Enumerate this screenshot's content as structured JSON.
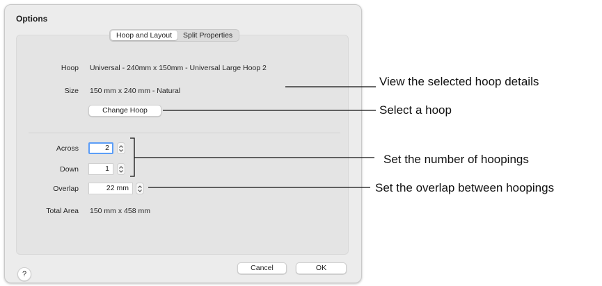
{
  "dialog": {
    "title": "Options",
    "tabs": [
      {
        "label": "Hoop and Layout",
        "active": true
      },
      {
        "label": "Split Properties",
        "active": false
      }
    ],
    "hoop": {
      "label": "Hoop",
      "value": "Universal - 240mm x 150mm - Universal Large Hoop 2"
    },
    "size": {
      "label": "Size",
      "value": "150 mm x 240 mm - Natural"
    },
    "change_hoop_label": "Change Hoop",
    "across": {
      "label": "Across",
      "value": "2"
    },
    "down": {
      "label": "Down",
      "value": "1"
    },
    "overlap": {
      "label": "Overlap",
      "value": "22 mm"
    },
    "total_area": {
      "label": "Total Area",
      "value": "150 mm x 458 mm"
    },
    "help_label": "?",
    "cancel_label": "Cancel",
    "ok_label": "OK"
  },
  "callouts": {
    "hoop_details": "View the selected hoop details",
    "select_hoop": "Select a hoop",
    "hoopings": "Set the number of hoopings",
    "overlap": "Set the overlap between hoopings"
  },
  "colors": {
    "dialog_bg": "#ececec",
    "focus_ring": "#5b9df7"
  },
  "icons": {
    "stepper": "chevron-up-down-icon"
  }
}
